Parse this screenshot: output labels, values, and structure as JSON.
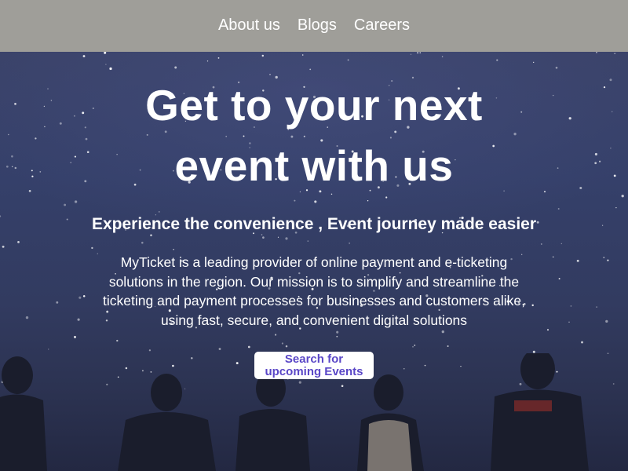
{
  "nav": {
    "links": [
      "About us",
      "Blogs",
      "Careers"
    ]
  },
  "hero": {
    "headline": "Get to your next event with us",
    "subheadline": "Experience the convenience , Event journey made easier",
    "description": "MyTicket is a leading provider of online payment and e-ticketing solutions in the region. Our mission is to simplify and streamline the ticketing and payment processes for businesses and customers alike, using fast, secure, and convenient digital solutions",
    "cta_label": "Search for upcoming Events"
  },
  "colors": {
    "nav_background": "#9f9e99",
    "hero_background": "#323b60",
    "cta_text": "#5a47c7",
    "text": "#ffffff"
  }
}
